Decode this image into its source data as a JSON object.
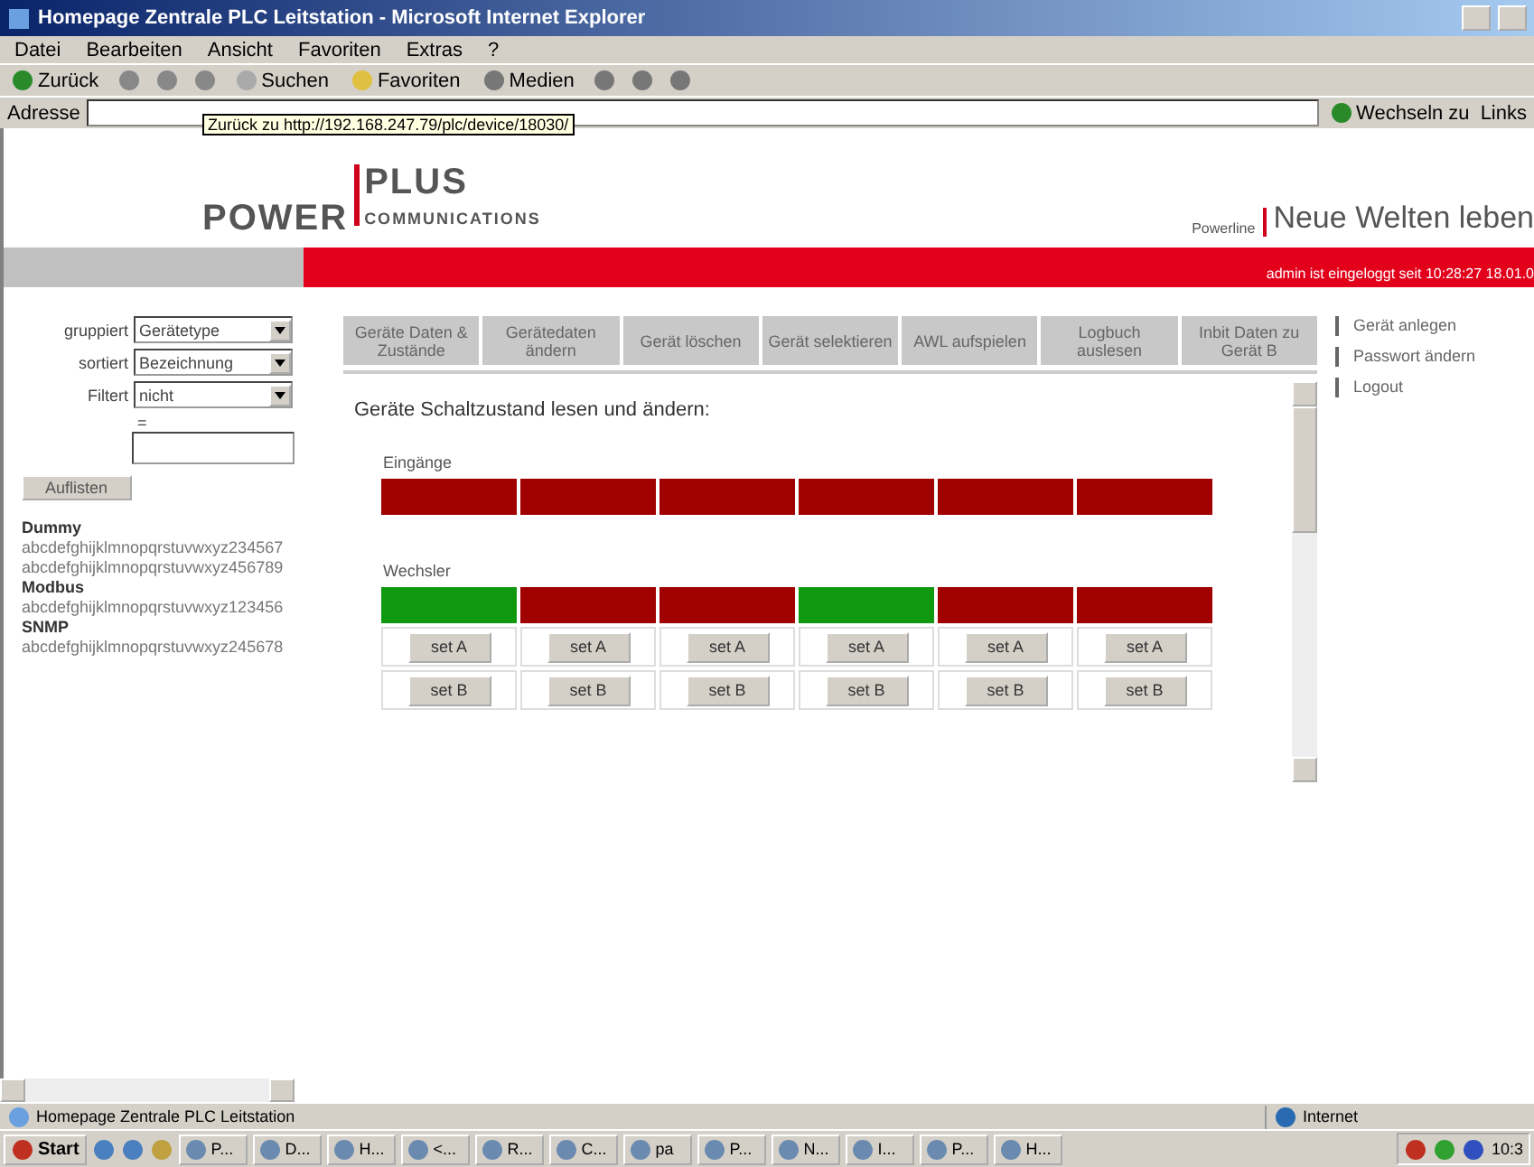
{
  "window": {
    "title": "Homepage Zentrale PLC Leitstation - Microsoft Internet Explorer"
  },
  "menu": [
    "Datei",
    "Bearbeiten",
    "Ansicht",
    "Favoriten",
    "Extras",
    "?"
  ],
  "toolbar": {
    "back": "Zurück",
    "search": "Suchen",
    "favorites": "Favoriten",
    "media": "Medien"
  },
  "address": {
    "label": "Adresse",
    "tooltip": "Zurück zu http://192.168.247.79/plc/device/18030/",
    "go": "Wechseln zu",
    "links": "Links"
  },
  "header": {
    "logo_left": "POWER",
    "logo_right": "PLUS",
    "logo_sub": "COMMUNICATIONS",
    "tagline_small": "Powerline",
    "tagline": "Neue Welten leben",
    "login": "admin ist eingeloggt seit 10:28:27 18.01.0"
  },
  "filters": [
    {
      "label": "gruppiert",
      "value": "Gerätetype"
    },
    {
      "label": "sortiert",
      "value": "Bezeichnung"
    },
    {
      "label": "Filtert",
      "value": "nicht"
    }
  ],
  "filter_eq": "=",
  "list_button": "Auflisten",
  "devices": [
    {
      "kind": "group",
      "text": "Dummy"
    },
    {
      "kind": "item",
      "text": "abcdefghijklmnopqrstuvwxyz234567"
    },
    {
      "kind": "item",
      "text": "abcdefghijklmnopqrstuvwxyz456789"
    },
    {
      "kind": "group",
      "text": "Modbus"
    },
    {
      "kind": "item",
      "text": "abcdefghijklmnopqrstuvwxyz123456"
    },
    {
      "kind": "group",
      "text": "SNMP"
    },
    {
      "kind": "item",
      "text": "abcdefghijklmnopqrstuvwxyz245678"
    }
  ],
  "tabs": [
    {
      "label": "Geräte Daten & Zustände",
      "selected": false
    },
    {
      "label": "Gerätedaten ändern",
      "selected": false
    },
    {
      "label": "Gerät löschen",
      "selected": false
    },
    {
      "label": "Gerät selektieren",
      "selected": false
    },
    {
      "label": "AWL aufspielen",
      "selected": false
    },
    {
      "label": "Logbuch auslesen",
      "selected": false
    },
    {
      "label": "Inbit Daten zu Gerät B",
      "selected": false
    }
  ],
  "content": {
    "title": "Geräte Schaltzustand lesen und ändern:",
    "inputs": {
      "label": "Eingänge",
      "cells": [
        {
          "on": false
        },
        {
          "on": false
        },
        {
          "on": false
        },
        {
          "on": false
        },
        {
          "on": false
        },
        {
          "on": false
        }
      ]
    },
    "switches": {
      "label": "Wechsler",
      "cells": [
        {
          "on": true
        },
        {
          "on": false
        },
        {
          "on": false
        },
        {
          "on": true
        },
        {
          "on": false
        },
        {
          "on": false
        }
      ]
    },
    "set_a": [
      "set A",
      "set A",
      "set A",
      "set A",
      "set A",
      "set A"
    ],
    "set_b": [
      "set B",
      "set B",
      "set B",
      "set B",
      "set B",
      "set B"
    ]
  },
  "side_links": [
    "Gerät anlegen",
    "Passwort ändern",
    "Logout"
  ],
  "status_bar": {
    "text": "Homepage Zentrale PLC Leitstation",
    "zone": "Internet"
  },
  "taskbar": {
    "start": "Start",
    "items": [
      "P...",
      "D...",
      "H...",
      "<...",
      "R...",
      "C...",
      "pa",
      "P...",
      "N...",
      "I...",
      "P...",
      "H..."
    ],
    "clock": "10:3"
  }
}
